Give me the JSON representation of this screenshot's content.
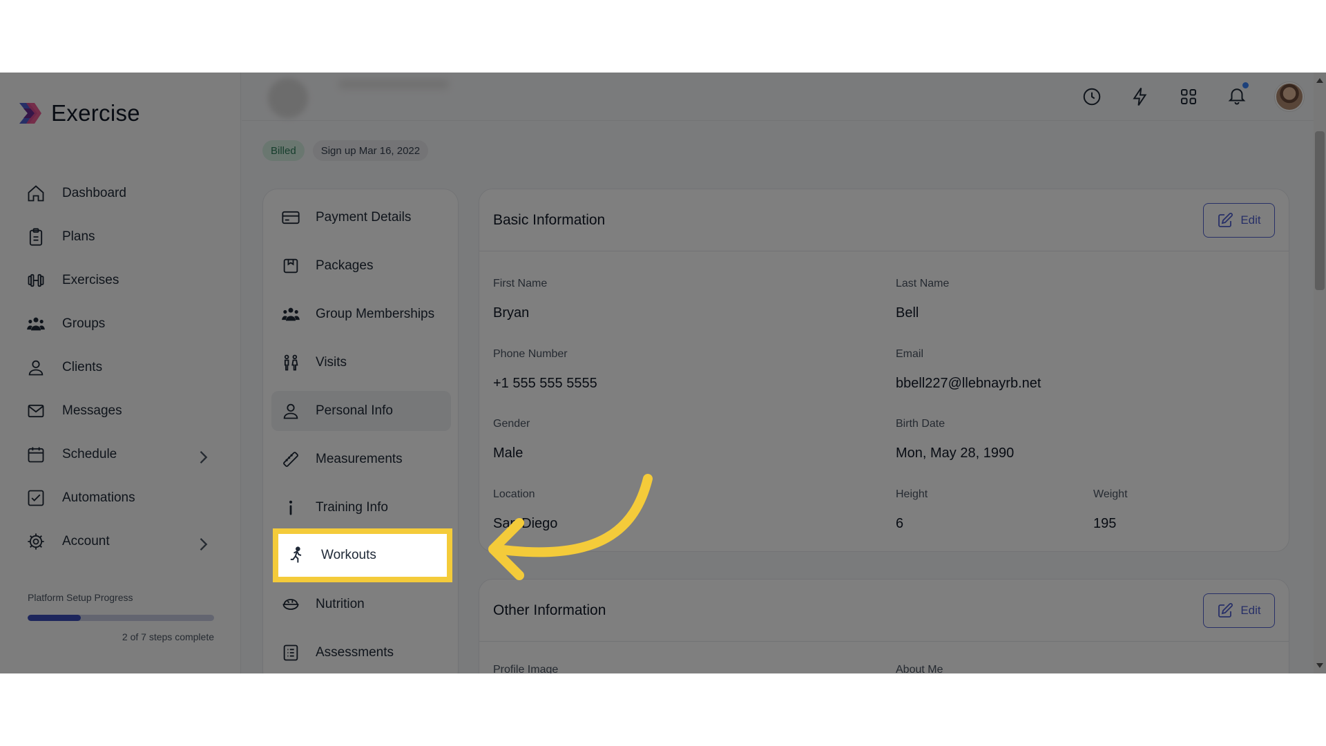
{
  "brand": {
    "name": "Exercise"
  },
  "nav": {
    "items": [
      {
        "label": "Dashboard",
        "icon": "home-icon"
      },
      {
        "label": "Plans",
        "icon": "clipboard-icon"
      },
      {
        "label": "Exercises",
        "icon": "dumbbell-icon"
      },
      {
        "label": "Groups",
        "icon": "users-icon"
      },
      {
        "label": "Clients",
        "icon": "user-icon"
      },
      {
        "label": "Messages",
        "icon": "mail-icon"
      },
      {
        "label": "Schedule",
        "icon": "calendar-icon"
      },
      {
        "label": "Automations",
        "icon": "checkbox-icon"
      },
      {
        "label": "Account",
        "icon": "gear-icon"
      }
    ]
  },
  "progress": {
    "label": "Platform Setup Progress",
    "count_text": "2 of 7 steps complete",
    "done": 2,
    "total": 7
  },
  "badges": {
    "billed": "Billed",
    "signup": "Sign up Mar 16, 2022"
  },
  "submenu": {
    "items": [
      {
        "label": "Payment Details"
      },
      {
        "label": "Packages"
      },
      {
        "label": "Group Memberships"
      },
      {
        "label": "Visits"
      },
      {
        "label": "Personal Info"
      },
      {
        "label": "Measurements"
      },
      {
        "label": "Training Info"
      },
      {
        "label": "Workouts"
      },
      {
        "label": "Nutrition"
      },
      {
        "label": "Assessments"
      }
    ]
  },
  "basic": {
    "title": "Basic Information",
    "edit_label": "Edit",
    "first_name": {
      "label": "First Name",
      "value": "Bryan"
    },
    "last_name": {
      "label": "Last Name",
      "value": "Bell"
    },
    "phone": {
      "label": "Phone Number",
      "value": "+1 555 555 5555"
    },
    "email": {
      "label": "Email",
      "value": "bbell227@llebnayrb.net"
    },
    "gender": {
      "label": "Gender",
      "value": "Male"
    },
    "birth": {
      "label": "Birth Date",
      "value": "Mon, May 28, 1990"
    },
    "location": {
      "label": "Location",
      "value": "San Diego"
    },
    "height": {
      "label": "Height",
      "value": "6"
    },
    "weight": {
      "label": "Weight",
      "value": "195"
    }
  },
  "other": {
    "title": "Other Information",
    "edit_label": "Edit",
    "profile_image_label": "Profile Image",
    "about_me_label": "About Me"
  },
  "colors": {
    "accent": "#4f5fcf",
    "highlight": "#f4cb3a",
    "billed_bg": "#d4efe1"
  }
}
